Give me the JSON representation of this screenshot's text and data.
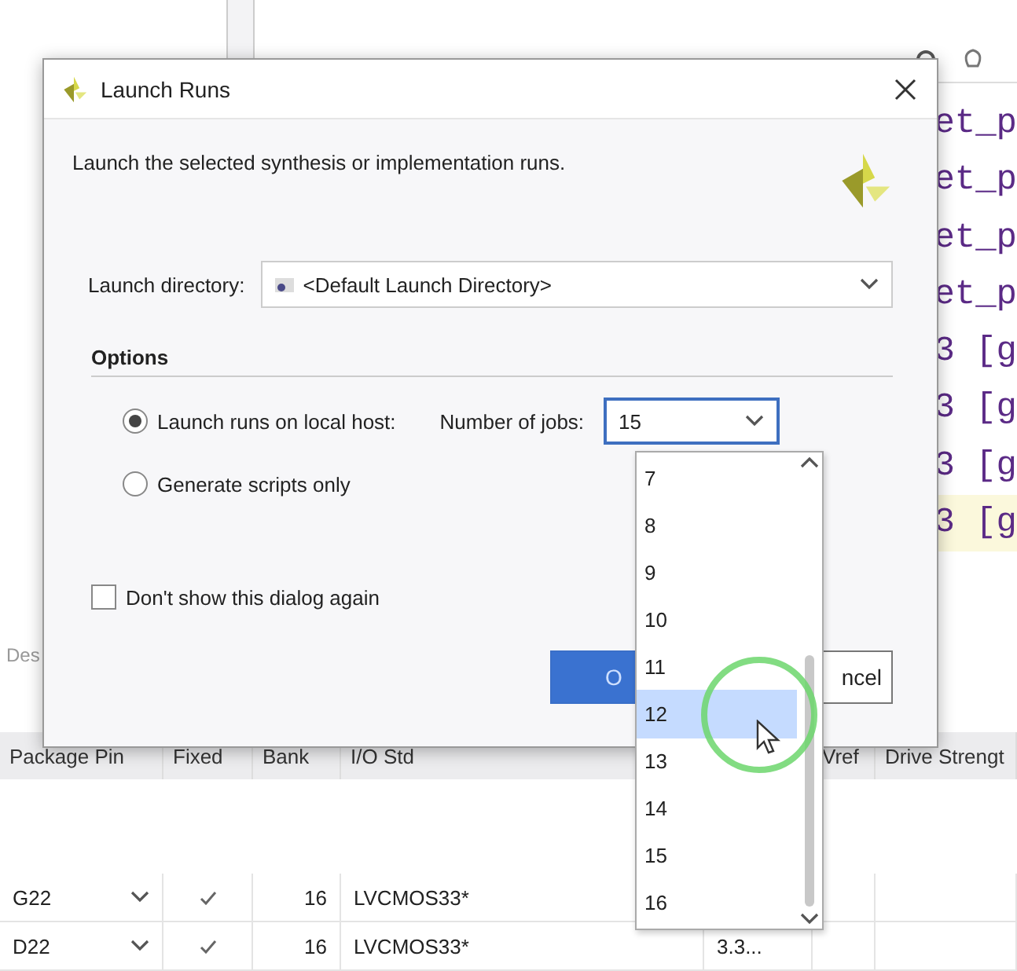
{
  "editor": {
    "lines": [
      "et_p",
      "et_p",
      "et_p",
      "et_p",
      "3 [g",
      "3 [g",
      "3 [g",
      "3 [g"
    ]
  },
  "side_tab": "Des",
  "table": {
    "columns": [
      "Package Pin",
      "Fixed",
      "Bank",
      "I/O Std",
      "",
      "Vref",
      "Drive Strengt"
    ],
    "rows": [
      {
        "pin": "G22",
        "fixed": true,
        "bank": "16",
        "io_std": "LVCMOS33*",
        "column_5": ""
      },
      {
        "pin": "D22",
        "fixed": true,
        "bank": "16",
        "io_std": "LVCMOS33*",
        "column_5": "3.3..."
      }
    ]
  },
  "dialog": {
    "title": "Launch Runs",
    "description": "Launch the selected synthesis or implementation runs.",
    "directory_label": "Launch directory:",
    "directory_value": "<Default Launch Directory>",
    "options_heading": "Options",
    "radios": [
      {
        "label": "Launch runs on local host:",
        "selected": true
      },
      {
        "label": "Generate scripts only",
        "selected": false
      }
    ],
    "jobs_label": "Number of jobs:",
    "jobs_value": "15",
    "dont_show": {
      "label": "Don't show this dialog again",
      "checked": false
    },
    "buttons": [
      {
        "label": "O",
        "kind": "primary"
      },
      {
        "label": "ncel",
        "kind": "secondary"
      }
    ]
  },
  "jobs_list": [
    {
      "label": "7",
      "selected": false
    },
    {
      "label": "8",
      "selected": false
    },
    {
      "label": "9",
      "selected": false
    },
    {
      "label": "10",
      "selected": false
    },
    {
      "label": "11",
      "selected": false
    },
    {
      "label": "12",
      "selected": true
    },
    {
      "label": "13",
      "selected": false
    },
    {
      "label": "14",
      "selected": false
    },
    {
      "label": "15",
      "selected": false
    },
    {
      "label": "16",
      "selected": false
    }
  ]
}
